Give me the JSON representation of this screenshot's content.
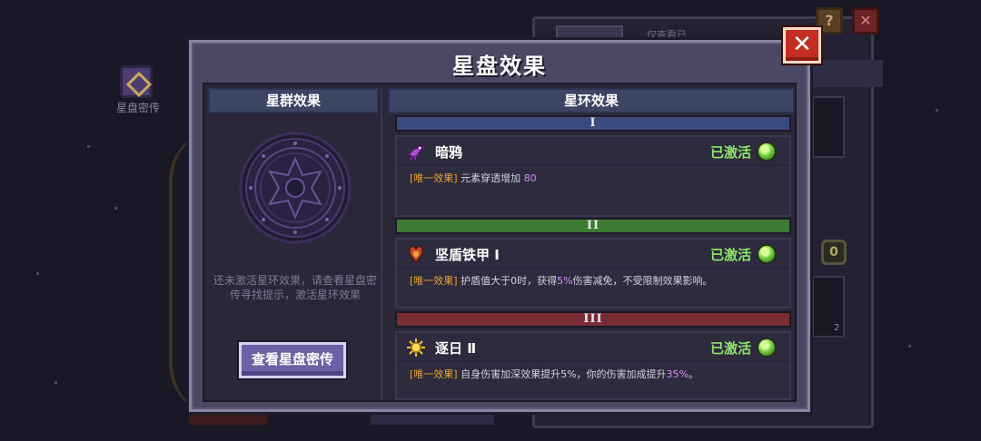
{
  "background": {
    "left_label": "星盘密传",
    "right_tab_text": "仅查看已",
    "slot_count": "2",
    "coin_glyph": "0",
    "help_glyph": "?",
    "close_glyph": "✕"
  },
  "dialog": {
    "title": "星盘效果",
    "close_glyph": "✕"
  },
  "cluster": {
    "header": "星群效果",
    "hint": "还未激活星环效果，请查看星盘密传寻找提示，激活星环效果",
    "lore_button": "查看星盘密传"
  },
  "rings": {
    "header": "星环效果",
    "items": [
      {
        "numeral": "I",
        "banner_color": "#3b4a7c",
        "icon": "crow-icon",
        "name": "暗鸦",
        "status": "已激活",
        "tag": "[唯一效果]",
        "desc_before": " 元素穿透增加 ",
        "desc_value": "80",
        "desc_mid": "",
        "desc_value2": "",
        "desc_after": ""
      },
      {
        "numeral": "II",
        "banner_color": "#3d7a32",
        "icon": "shield-armor-icon",
        "name": "坚盾铁甲 Ⅰ",
        "status": "已激活",
        "tag": "[唯一效果]",
        "desc_before": " 护盾值大于0时，获得",
        "desc_value": "5%",
        "desc_mid": "伤害减免，不受限制效果影响。",
        "desc_value2": "",
        "desc_after": ""
      },
      {
        "numeral": "III",
        "banner_color": "#7a2c34",
        "icon": "sun-icon",
        "name": "逐日 Ⅱ",
        "status": "已激活",
        "tag": "[唯一效果]",
        "desc_before": " 自身伤害加深效果提升5%，你的伤害加成提升",
        "desc_value": "35%",
        "desc_mid": "。",
        "desc_value2": "",
        "desc_after": ""
      }
    ]
  }
}
